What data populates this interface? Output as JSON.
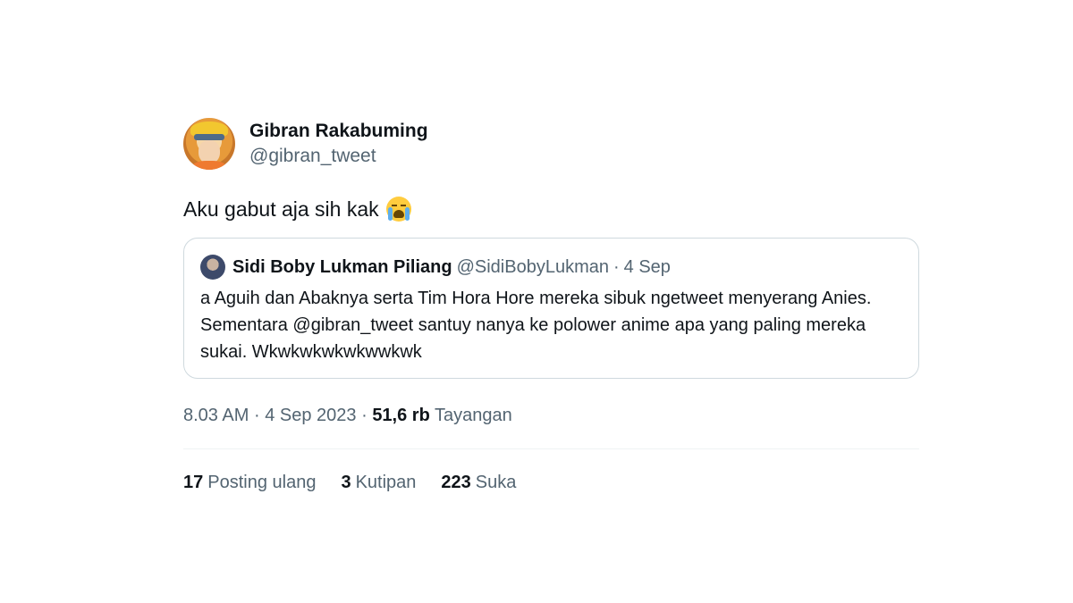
{
  "tweet": {
    "author": {
      "display_name": "Gibran Rakabuming",
      "handle": "@gibran_tweet"
    },
    "text": "Aku gabut aja sih kak",
    "emoji": "loudly-crying-face-emoji",
    "quoted": {
      "display_name": "Sidi Boby Lukman Piliang",
      "handle": "@SidiBobyLukman",
      "separator": "·",
      "time": "4 Sep",
      "body": "a Aguih dan Abaknya serta Tim Hora Hore mereka sibuk ngetweet menyerang Anies. Sementara @gibran_tweet santuy nanya ke polower anime apa yang paling mereka sukai. Wkwkwkwkwkwwkwk"
    },
    "meta": {
      "time": "8.03 AM",
      "sep1": "·",
      "date": "4 Sep 2023",
      "sep2": "·",
      "views_count": "51,6 rb",
      "views_label": "Tayangan"
    },
    "stats": {
      "reposts_count": "17",
      "reposts_label": "Posting ulang",
      "quotes_count": "3",
      "quotes_label": "Kutipan",
      "likes_count": "223",
      "likes_label": "Suka"
    }
  }
}
